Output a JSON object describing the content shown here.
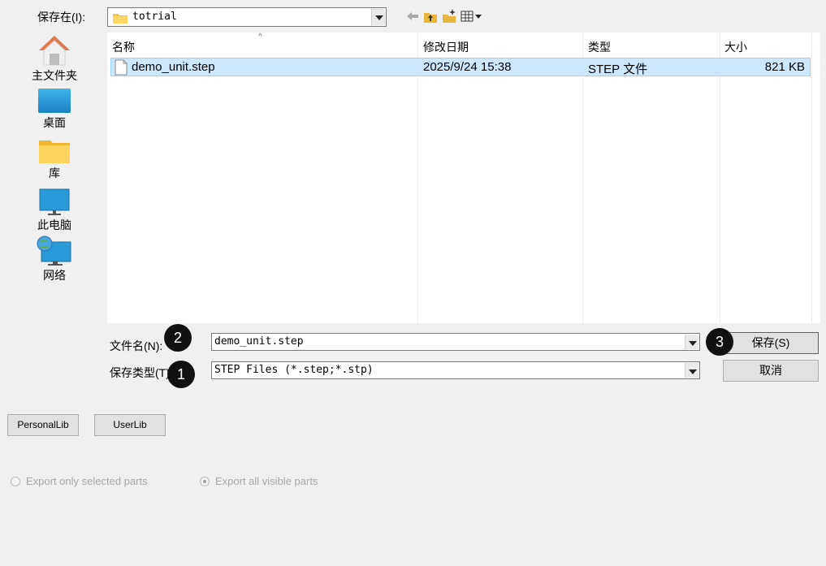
{
  "top": {
    "save_in_label": "保存在(I):",
    "folder": "totrial",
    "icons": [
      "back-arrow-icon",
      "up-folder-icon",
      "new-folder-icon",
      "view-menu-icon"
    ]
  },
  "places": [
    {
      "label": "主文件夹",
      "icon": "home-icon"
    },
    {
      "label": "桌面",
      "icon": "desktop-icon"
    },
    {
      "label": "库",
      "icon": "library-folder-icon"
    },
    {
      "label": "此电脑",
      "icon": "computer-icon"
    },
    {
      "label": "网络",
      "icon": "network-icon"
    }
  ],
  "file_list": {
    "columns": [
      "名称",
      "修改日期",
      "类型",
      "大小"
    ],
    "rows": [
      {
        "name": "demo_unit.step",
        "modified": "2025/9/24 15:38",
        "type": "STEP 文件",
        "size": "821 KB",
        "selected": true
      }
    ]
  },
  "form": {
    "filename_label": "文件名(N):",
    "filename_value": "demo_unit.step",
    "filetype_label": "保存类型(T):",
    "filetype_value": "STEP Files (*.step;*.stp)",
    "save_button": "保存(S)",
    "cancel_button": "取消"
  },
  "badges": [
    "2",
    "1",
    "3"
  ],
  "lib_buttons": {
    "personal": "PersonalLib",
    "user": "UserLib"
  },
  "export_options": {
    "selected_parts": "Export only selected parts",
    "all_visible": "Export all visible parts",
    "checked": "all_visible"
  },
  "colors": {
    "selection": "#cce8ff",
    "selection_border": "#99d1ff",
    "background": "#f0f0f0"
  }
}
